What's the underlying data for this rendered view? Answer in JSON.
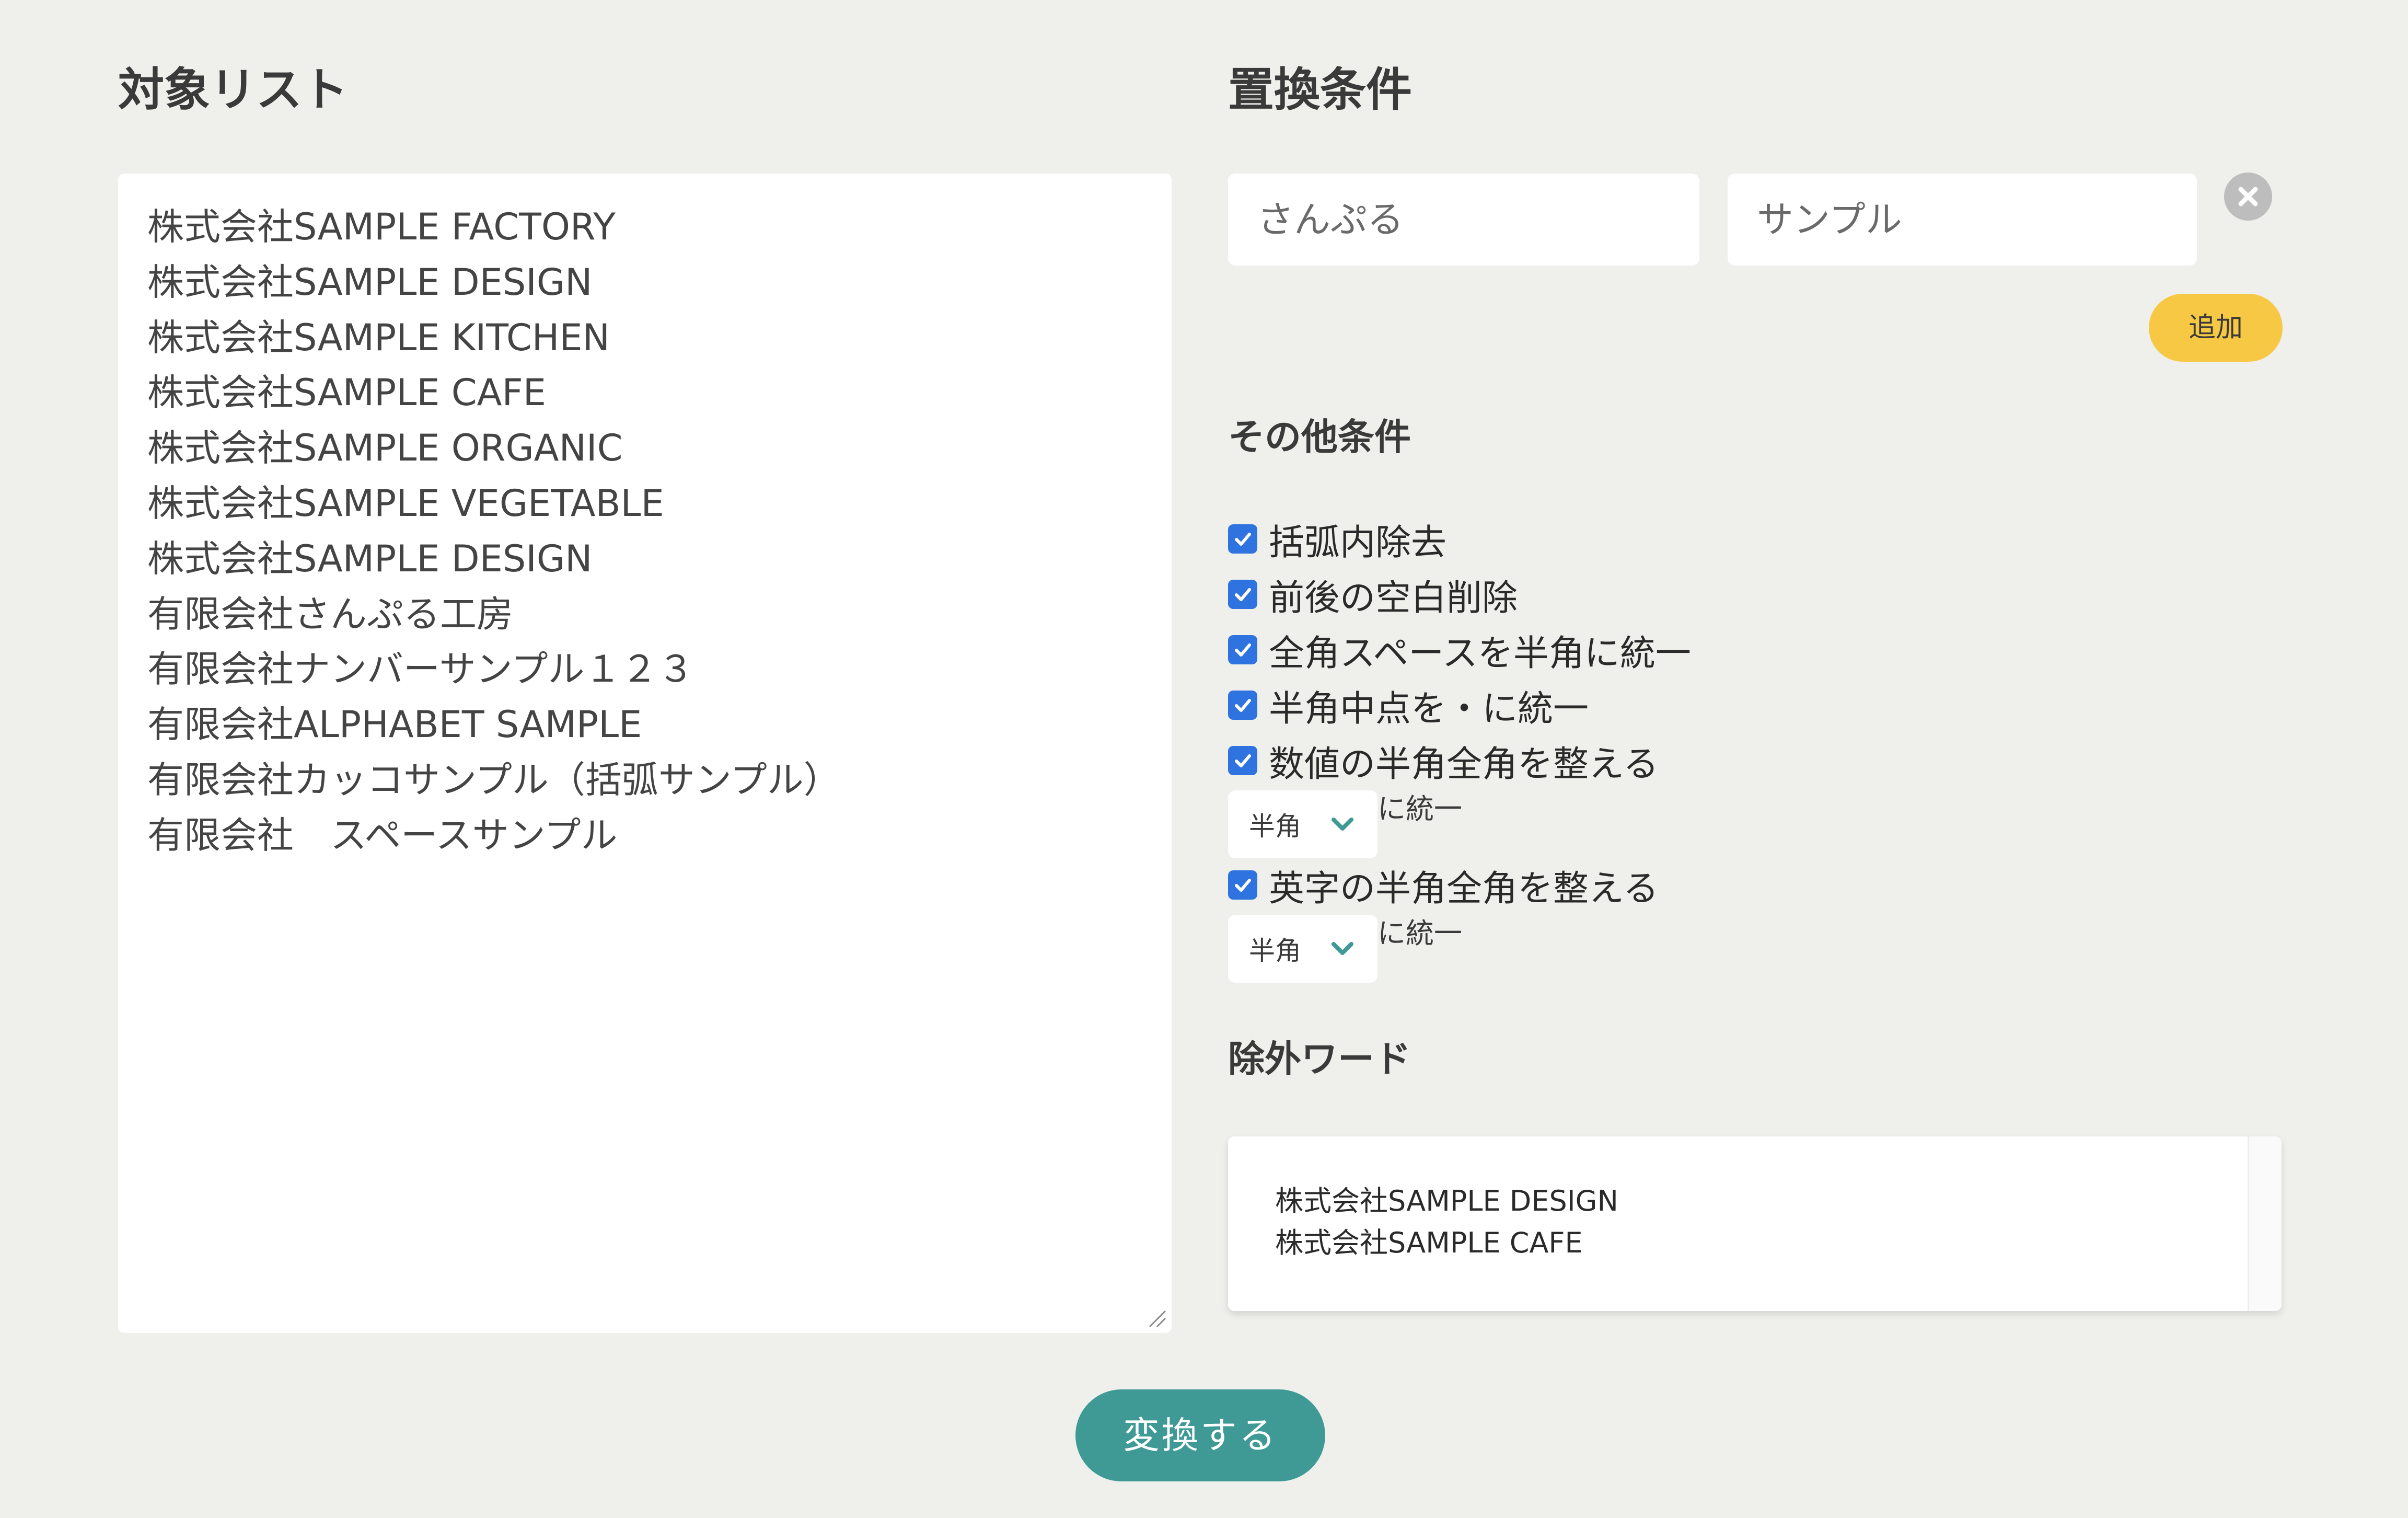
{
  "target": {
    "heading": "対象リスト",
    "lines": [
      "株式会社SAMPLE FACTORY",
      "株式会社SAMPLE DESIGN",
      "株式会社SAMPLE KITCHEN",
      "株式会社SAMPLE CAFE",
      "株式会社SAMPLE ORGANIC",
      "株式会社SAMPLE VEGETABLE",
      "株式会社SAMPLE DESIGN",
      "有限会社さんぷる工房",
      "有限会社ナンバーサンプル１２３",
      "有限会社ALPHABET SAMPLE",
      "有限会社カッコサンプル（括弧サンプル）",
      "有限会社　スペースサンプル"
    ]
  },
  "replace": {
    "heading": "置換条件",
    "from_value": "さんぷる",
    "to_value": "サンプル",
    "add_label": "追加",
    "close_icon": "close-icon"
  },
  "other": {
    "heading": "その他条件",
    "checkboxes": [
      {
        "label": "括弧内除去",
        "checked": true
      },
      {
        "label": "前後の空白削除",
        "checked": true
      },
      {
        "label": "全角スペースを半角に統一",
        "checked": true
      },
      {
        "label": "半角中点を・に統一",
        "checked": true
      },
      {
        "label": "数値の半角全角を整える",
        "checked": true
      },
      {
        "label": "英字の半角全角を整える",
        "checked": true
      }
    ],
    "number_select": {
      "value": "半角",
      "suffix": "に統一"
    },
    "alpha_select": {
      "value": "半角",
      "suffix": "に統一"
    }
  },
  "exclude": {
    "heading": "除外ワード",
    "lines": [
      "株式会社SAMPLE DESIGN",
      "株式会社SAMPLE CAFE"
    ]
  },
  "convert_label": "変換する",
  "colors": {
    "background": "#efefeb",
    "checkbox": "#2f73e0",
    "add_button": "#f7c843",
    "convert_button": "#3f9a96",
    "chevron": "#3f9a96"
  }
}
